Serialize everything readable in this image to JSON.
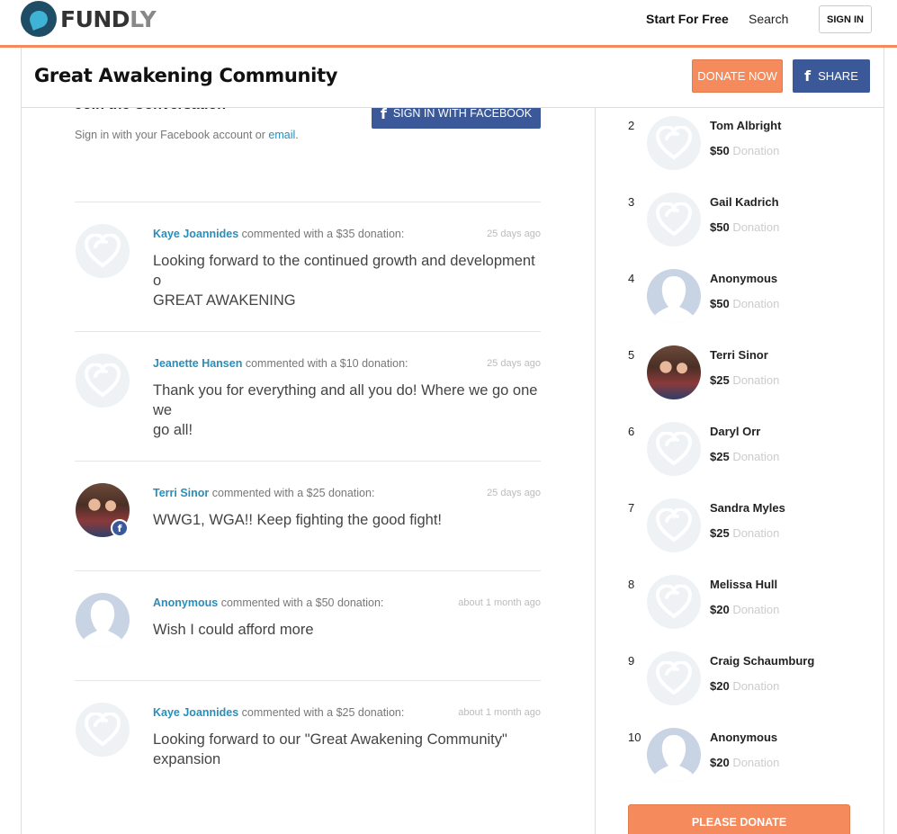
{
  "nav": {
    "logo_main": "FUND",
    "logo_accent": "LY",
    "start_label": "Start For Free",
    "search_label": "Search",
    "signin_label": "SIGN IN"
  },
  "campaign": {
    "title": "Great Awakening Community",
    "donate_now_label": "DONATE NOW",
    "share_label": "SHARE"
  },
  "join": {
    "title": "Join the Conversation",
    "subtitle_prefix": "Sign in with your Facebook account or ",
    "subtitle_link": "email",
    "subtitle_suffix": ".",
    "fb_button_label": "SIGN IN WITH FACEBOOK"
  },
  "comments": [
    {
      "name": "Kaye Joannides",
      "action": " commented with a $35 donation:",
      "time": "25 days ago",
      "text": "Looking forward to the continued growth and development o\nGREAT AWAKENING",
      "avatar": "heart-icon"
    },
    {
      "name": "Jeanette Hansen",
      "action": " commented with a $10 donation:",
      "time": "25 days ago",
      "text": "Thank you for everything and all you do! Where we go one we\ngo all!",
      "avatar": "heart-icon"
    },
    {
      "name": "Terri Sinor",
      "action": " commented with a $25 donation:",
      "time": "25 days ago",
      "text": "WWG1, WGA!! Keep fighting the good fight!",
      "avatar": "photo"
    },
    {
      "name": "Anonymous",
      "action": " commented with a $50 donation:",
      "time": "about 1 month ago",
      "text": "Wish I could afford more",
      "avatar": "person-silhouette-icon"
    },
    {
      "name": "Kaye Joannides",
      "action": " commented with a $25 donation:",
      "time": "about 1 month ago",
      "text": "Looking forward to our \"Great Awakening Community\"\nexpansion",
      "avatar": "heart-icon"
    }
  ],
  "donors": [
    {
      "rank": "2",
      "name": "Tom Albright",
      "amount": "$50",
      "label": "Donation",
      "avatar": "heart-icon"
    },
    {
      "rank": "3",
      "name": "Gail Kadrich",
      "amount": "$50",
      "label": "Donation",
      "avatar": "heart-icon"
    },
    {
      "rank": "4",
      "name": "Anonymous",
      "amount": "$50",
      "label": "Donation",
      "avatar": "person-silhouette-icon"
    },
    {
      "rank": "5",
      "name": "Terri Sinor",
      "amount": "$25",
      "label": "Donation",
      "avatar": "photo"
    },
    {
      "rank": "6",
      "name": "Daryl Orr",
      "amount": "$25",
      "label": "Donation",
      "avatar": "heart-icon"
    },
    {
      "rank": "7",
      "name": "Sandra Myles",
      "amount": "$25",
      "label": "Donation",
      "avatar": "heart-icon"
    },
    {
      "rank": "8",
      "name": "Melissa Hull",
      "amount": "$20",
      "label": "Donation",
      "avatar": "heart-icon"
    },
    {
      "rank": "9",
      "name": "Craig Schaumburg",
      "amount": "$20",
      "label": "Donation",
      "avatar": "heart-icon"
    },
    {
      "rank": "10",
      "name": "Anonymous",
      "amount": "$20",
      "label": "Donation",
      "avatar": "person-silhouette-icon"
    }
  ],
  "please_donate_label": "PLEASE DONATE",
  "colors": {
    "accent_orange": "#f58a5c",
    "facebook_blue": "#3b5998",
    "link_blue": "#2a8db8"
  }
}
